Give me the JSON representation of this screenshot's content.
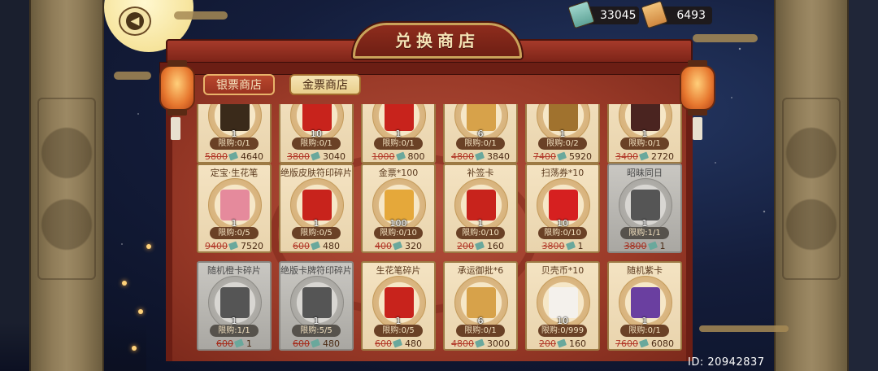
{
  "header": {
    "title": "兑换商店",
    "back_icon": "back-arrow-icon"
  },
  "currency": [
    {
      "name": "silver-ticket",
      "value": "33045",
      "icon": "silver-ticket-icon",
      "color": "#7fc1b5"
    },
    {
      "name": "gold-ticket",
      "value": "6493",
      "icon": "gold-ticket-icon",
      "color": "#e5a55a"
    }
  ],
  "tabs": [
    {
      "label": "银票商店",
      "active": false
    },
    {
      "label": "金票商店",
      "active": true
    }
  ],
  "items": [
    {
      "name": "",
      "count": "1",
      "limit": "限购:0/1",
      "old_price": "5800",
      "price": "4640",
      "grey": false,
      "icon": "gift-box-icon",
      "color": "#3a2a1a"
    },
    {
      "name": "",
      "count": "10",
      "limit": "限购:0/1",
      "old_price": "3800",
      "price": "3040",
      "grey": false,
      "icon": "red-talisman-icon",
      "color": "#c8231c"
    },
    {
      "name": "",
      "count": "1",
      "limit": "限购:0/1",
      "old_price": "1000",
      "price": "800",
      "grey": false,
      "icon": "fortune-charm-icon",
      "color": "#c8231c"
    },
    {
      "name": "",
      "count": "6",
      "limit": "限购:0/1",
      "old_price": "4800",
      "price": "3840",
      "grey": false,
      "icon": "scroll-icon",
      "color": "#d7a24a"
    },
    {
      "name": "",
      "count": "1",
      "limit": "限购:0/2",
      "old_price": "7400",
      "price": "5920",
      "grey": false,
      "icon": "bronze-token-icon",
      "color": "#a0722e"
    },
    {
      "name": "",
      "count": "1",
      "limit": "限购:0/1",
      "old_price": "3400",
      "price": "2720",
      "grey": false,
      "icon": "dark-card-icon",
      "color": "#4a2420"
    },
    {
      "name": "定宝·生花笔",
      "count": "1",
      "limit": "限购:0/5",
      "old_price": "9400",
      "price": "7520",
      "grey": false,
      "icon": "plum-blossom-brush-icon",
      "color": "#e58a9c"
    },
    {
      "name": "绝版皮肤符印碎片",
      "count": "1",
      "limit": "限购:0/5",
      "old_price": "600",
      "price": "480",
      "grey": false,
      "icon": "seal-fragment-icon",
      "color": "#c8231c"
    },
    {
      "name": "金票*100",
      "count": "100",
      "limit": "限购:0/10",
      "old_price": "400",
      "price": "320",
      "grey": false,
      "icon": "gold-ticket-icon",
      "color": "#e5a83a"
    },
    {
      "name": "补签卡",
      "count": "1",
      "limit": "限购:0/10",
      "old_price": "200",
      "price": "160",
      "grey": false,
      "icon": "sign-card-icon",
      "color": "#c8231c"
    },
    {
      "name": "扫荡券*10",
      "count": "10",
      "limit": "限购:0/10",
      "old_price": "3800",
      "price": "1",
      "grey": false,
      "icon": "sweep-ticket-icon",
      "color": "#d62020"
    },
    {
      "name": "昭昧同日",
      "count": "1",
      "limit": "限购:1/1",
      "old_price": "3800",
      "price": "1",
      "grey": true,
      "icon": "avatar-frame-icon",
      "color": "#555555"
    },
    {
      "name": "随机橙卡碎片",
      "count": "1",
      "limit": "限购:1/1",
      "old_price": "600",
      "price": "1",
      "grey": true,
      "icon": "mystery-card-icon",
      "color": "#555555"
    },
    {
      "name": "绝版卡牌符印碎片",
      "count": "1",
      "limit": "限购:5/5",
      "old_price": "600",
      "price": "480",
      "grey": true,
      "icon": "seal-fragment-icon",
      "color": "#555555"
    },
    {
      "name": "生花笔碎片",
      "count": "1",
      "limit": "限购:0/5",
      "old_price": "600",
      "price": "480",
      "grey": false,
      "icon": "brush-fragment-icon",
      "color": "#c8231c"
    },
    {
      "name": "承运御批*6",
      "count": "6",
      "limit": "限购:0/1",
      "old_price": "4800",
      "price": "3000",
      "grey": false,
      "icon": "scroll-icon",
      "color": "#d7a24a"
    },
    {
      "name": "贝壳币*10",
      "count": "10",
      "limit": "限购:0/999",
      "old_price": "200",
      "price": "160",
      "grey": false,
      "icon": "shell-icon",
      "color": "#f4f1ec"
    },
    {
      "name": "随机紫卡",
      "count": "1",
      "limit": "限购:0/1",
      "old_price": "7600",
      "price": "6080",
      "grey": false,
      "icon": "mystery-card-icon",
      "color": "#6a3fa0"
    }
  ],
  "footer": {
    "id_text": "ID: 20942837"
  }
}
